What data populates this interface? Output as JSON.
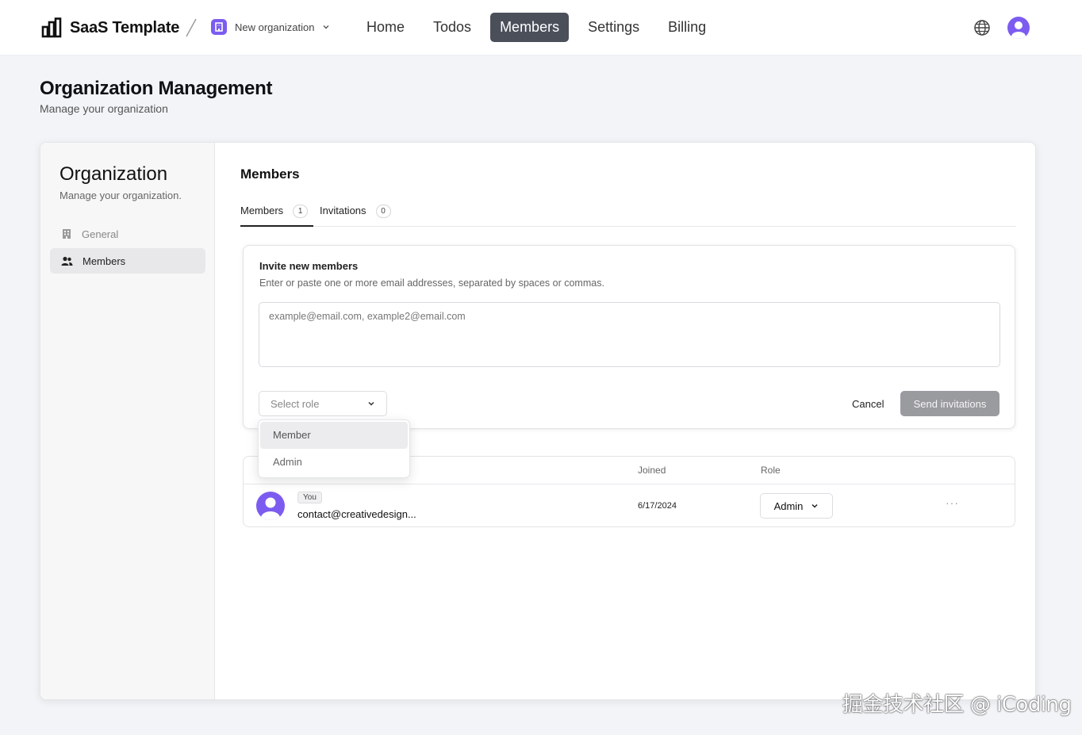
{
  "app": {
    "name": "SaaS Template"
  },
  "org_switcher": {
    "name": "New organization"
  },
  "nav": {
    "items": [
      "Home",
      "Todos",
      "Members",
      "Settings",
      "Billing"
    ],
    "active": "Members"
  },
  "page": {
    "title": "Organization Management",
    "subtitle": "Manage your organization"
  },
  "sidebar": {
    "title": "Organization",
    "subtitle": "Manage your organization.",
    "items": [
      {
        "label": "General",
        "icon": "building-icon"
      },
      {
        "label": "Members",
        "icon": "users-icon",
        "active": true
      }
    ]
  },
  "main": {
    "title": "Members",
    "tabs": [
      {
        "label": "Members",
        "count": "1",
        "active": true
      },
      {
        "label": "Invitations",
        "count": "0"
      }
    ]
  },
  "invite": {
    "title": "Invite new members",
    "description": "Enter or paste one or more email addresses, separated by spaces or commas.",
    "placeholder": "example@email.com, example2@email.com",
    "role_placeholder": "Select role",
    "cancel_label": "Cancel",
    "send_label": "Send invitations"
  },
  "role_dropdown": {
    "options": [
      "Member",
      "Admin"
    ],
    "highlighted": "Member"
  },
  "table": {
    "headers": {
      "joined": "Joined",
      "role": "Role"
    },
    "rows": [
      {
        "badge": "You",
        "email": "contact@creativedesign...",
        "joined": "6/17/2024",
        "role": "Admin"
      }
    ]
  },
  "watermark": "掘金技术社区 @ iCoding",
  "colors": {
    "accent": "#7c5cf0",
    "nav_active_bg": "#4a4f5a",
    "send_disabled": "#9a9b9f"
  }
}
